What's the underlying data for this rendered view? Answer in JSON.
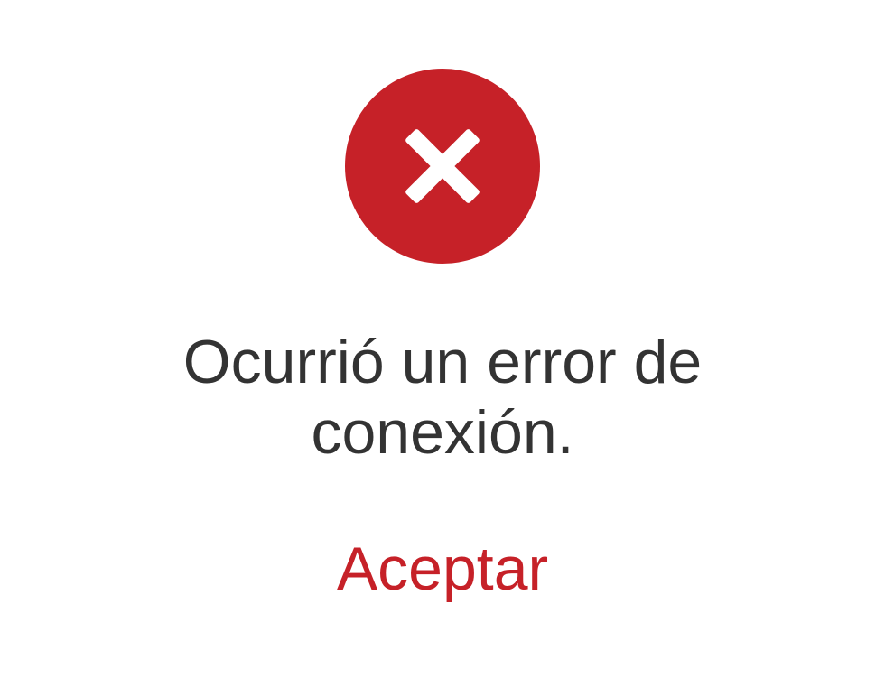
{
  "dialog": {
    "icon": "error-x-circle-icon",
    "message": "Ocurrió un error de conexión.",
    "accept_label": "Aceptar"
  },
  "colors": {
    "accent": "#c62128",
    "text": "#333333",
    "background": "#ffffff"
  }
}
